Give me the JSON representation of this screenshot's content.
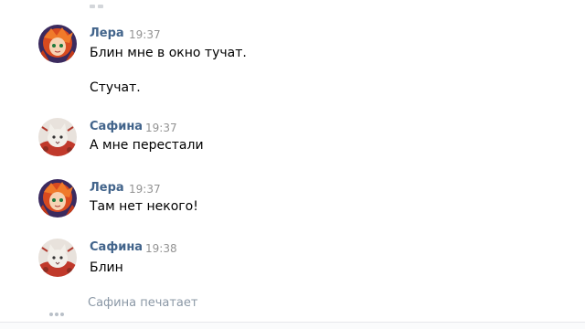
{
  "messages": [
    {
      "author": "Лера",
      "time": "19:37",
      "lines": [
        "Блин мне в окно тучат.",
        "Стучат."
      ]
    },
    {
      "author": "Сафина",
      "time": "19:37",
      "lines": [
        "А мне перестали"
      ]
    },
    {
      "author": "Лера",
      "time": "19:37",
      "lines": [
        "Там нет некого!"
      ]
    },
    {
      "author": "Сафина",
      "time": "19:38",
      "lines": [
        "Блин"
      ]
    }
  ],
  "typing_indicator": "Сафина печатает",
  "colors": {
    "author": "#42648b",
    "time": "#939393",
    "typing": "#8b98a6"
  },
  "icons": {
    "avatar_lera": "anime-avatar-orange-hair",
    "avatar_safina": "cat-avatar",
    "typing": "typing-dots-icon"
  }
}
